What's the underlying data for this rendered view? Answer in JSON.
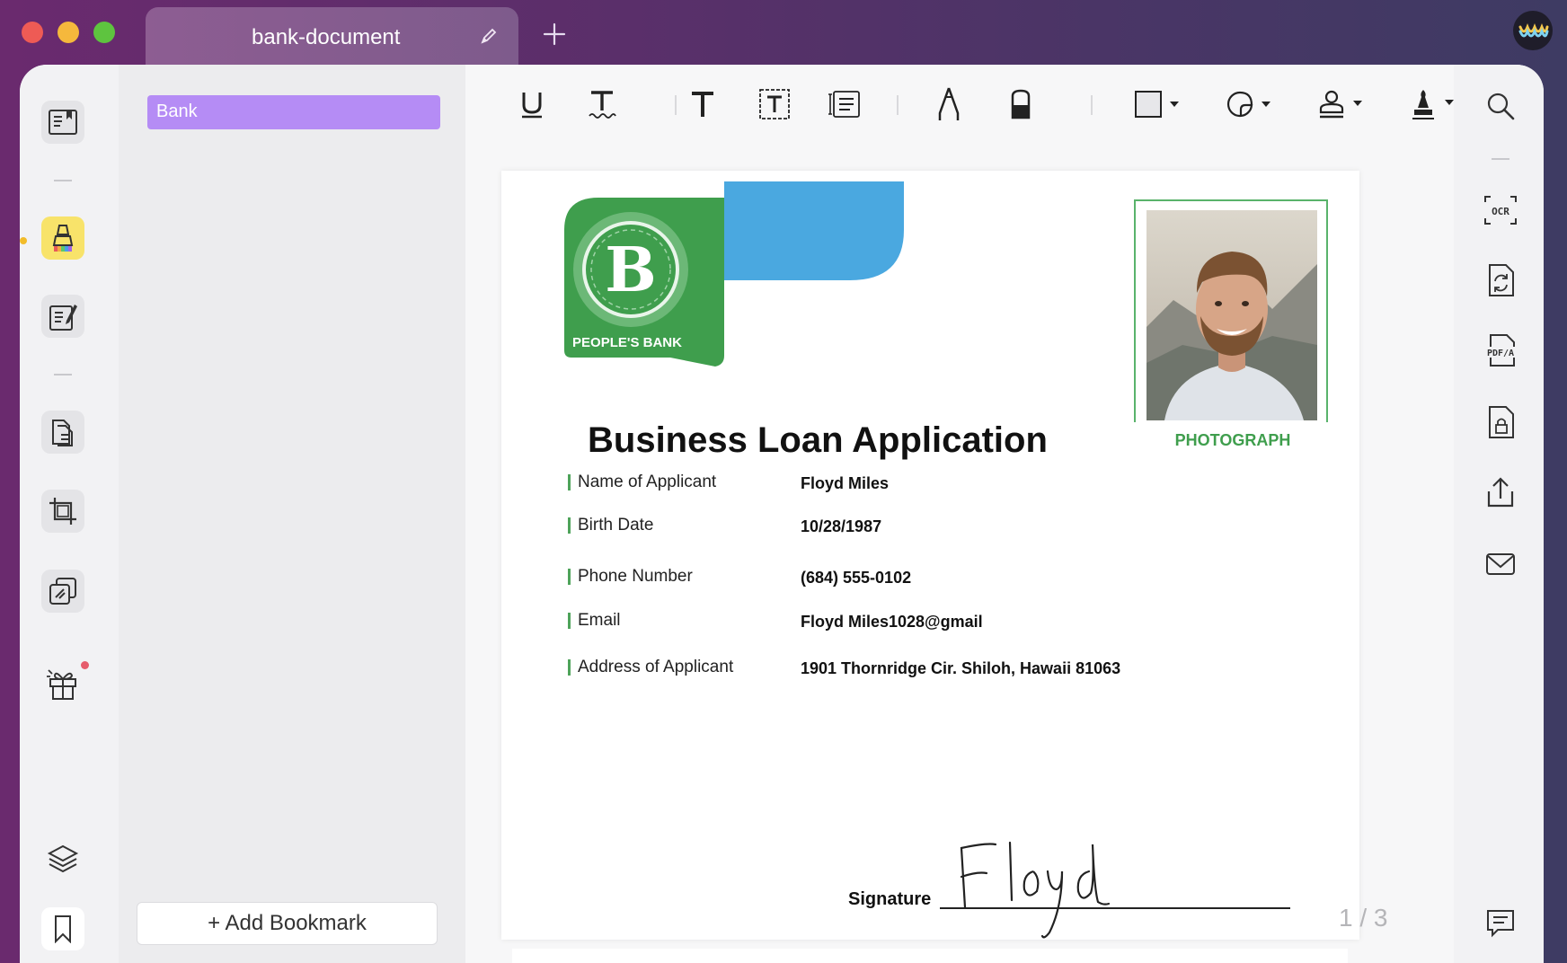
{
  "window": {
    "tab_title": "bank-document",
    "colors": {
      "close": "#ee5b55",
      "minimize": "#f5b83c",
      "zoom": "#5ec43f"
    }
  },
  "left_sidebar": {
    "items": [
      {
        "name": "reader",
        "icon": "reader-icon"
      },
      {
        "name": "comment",
        "icon": "highlighter-icon",
        "active": true
      },
      {
        "name": "edit",
        "icon": "edit-pdf-icon"
      },
      {
        "name": "organize",
        "icon": "organize-pages-icon"
      },
      {
        "name": "crop",
        "icon": "crop-icon"
      },
      {
        "name": "convert",
        "icon": "convert-icon"
      },
      {
        "name": "gift",
        "icon": "gift-icon"
      },
      {
        "name": "layers",
        "icon": "layers-icon"
      },
      {
        "name": "bookmarks",
        "icon": "bookmark-icon"
      }
    ]
  },
  "bookmark_panel": {
    "bookmarks": [
      {
        "label": "Bank"
      }
    ],
    "add_label": "+ Add Bookmark",
    "accent": "#b58cf5"
  },
  "toolbar": {
    "tools": [
      "underline-icon",
      "squiggly-icon",
      "text-icon",
      "text-box-icon",
      "text-callout-icon",
      "pencil-icon",
      "eraser-icon",
      "shape-icon",
      "sticker-icon",
      "stamp-icon",
      "signature-icon"
    ]
  },
  "right_sidebar": {
    "tools": [
      "search-icon",
      "ocr-icon",
      "convert-file-icon",
      "pdfa-icon",
      "protect-icon",
      "share-icon",
      "email-icon",
      "comment-list-icon"
    ]
  },
  "document": {
    "bank_name": "PEOPLE'S BANK",
    "logo_letter": "B",
    "photo_label": "PHOTOGRAPH",
    "title": "Business Loan Application",
    "fields": [
      {
        "label": "Name of Applicant",
        "value": "Floyd Miles"
      },
      {
        "label": "Birth Date",
        "value": "10/28/1987"
      },
      {
        "label": "Phone Number",
        "value": "(684) 555-0102"
      },
      {
        "label": "Email",
        "value": "Floyd Miles1028@gmail"
      },
      {
        "label": "Address of Applicant",
        "value": "1901 Thornridge Cir. Shiloh, Hawaii 81063"
      }
    ],
    "signature_label": "Signature",
    "signature_text": "Floyd",
    "page_current": "1",
    "page_total": "3",
    "page_sep": "/",
    "brand_green": "#3f9e4d",
    "brand_blue": "#4aa8e0"
  }
}
